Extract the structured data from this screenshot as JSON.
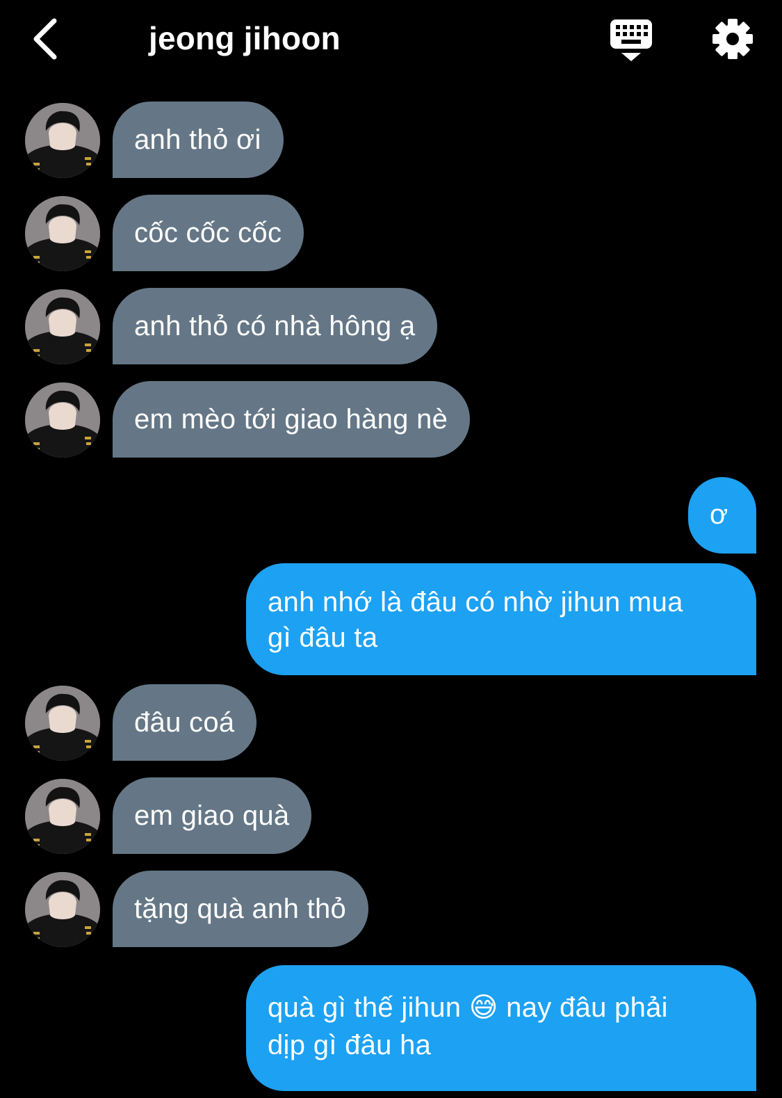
{
  "header": {
    "title": "jeong jihoon",
    "back_icon": "chevron-left-icon",
    "keyboard_icon": "keyboard-icon",
    "settings_icon": "gear-icon"
  },
  "colors": {
    "background": "#000000",
    "incoming_bubble": "#657786",
    "outgoing_bubble": "#1da1f2",
    "text": "#ffffff"
  },
  "messages": [
    {
      "from": "contact",
      "text": "anh thỏ ơi"
    },
    {
      "from": "contact",
      "text": "cốc cốc cốc"
    },
    {
      "from": "contact",
      "text": "anh thỏ có nhà hông ạ"
    },
    {
      "from": "contact",
      "text": "em mèo tới giao hàng nè"
    },
    {
      "from": "me",
      "text": "ơ"
    },
    {
      "from": "me",
      "lines": [
        "anh nhớ là đâu có nhờ jihun mua",
        "gì đâu ta"
      ]
    },
    {
      "from": "contact",
      "text": "đâu coá"
    },
    {
      "from": "contact",
      "text": "em giao quà"
    },
    {
      "from": "contact",
      "text": "tặng quà anh thỏ"
    },
    {
      "from": "me",
      "lines": [
        "quà gì thế jihun 😅 nay đâu phải",
        "dịp gì đâu ha"
      ]
    }
  ]
}
